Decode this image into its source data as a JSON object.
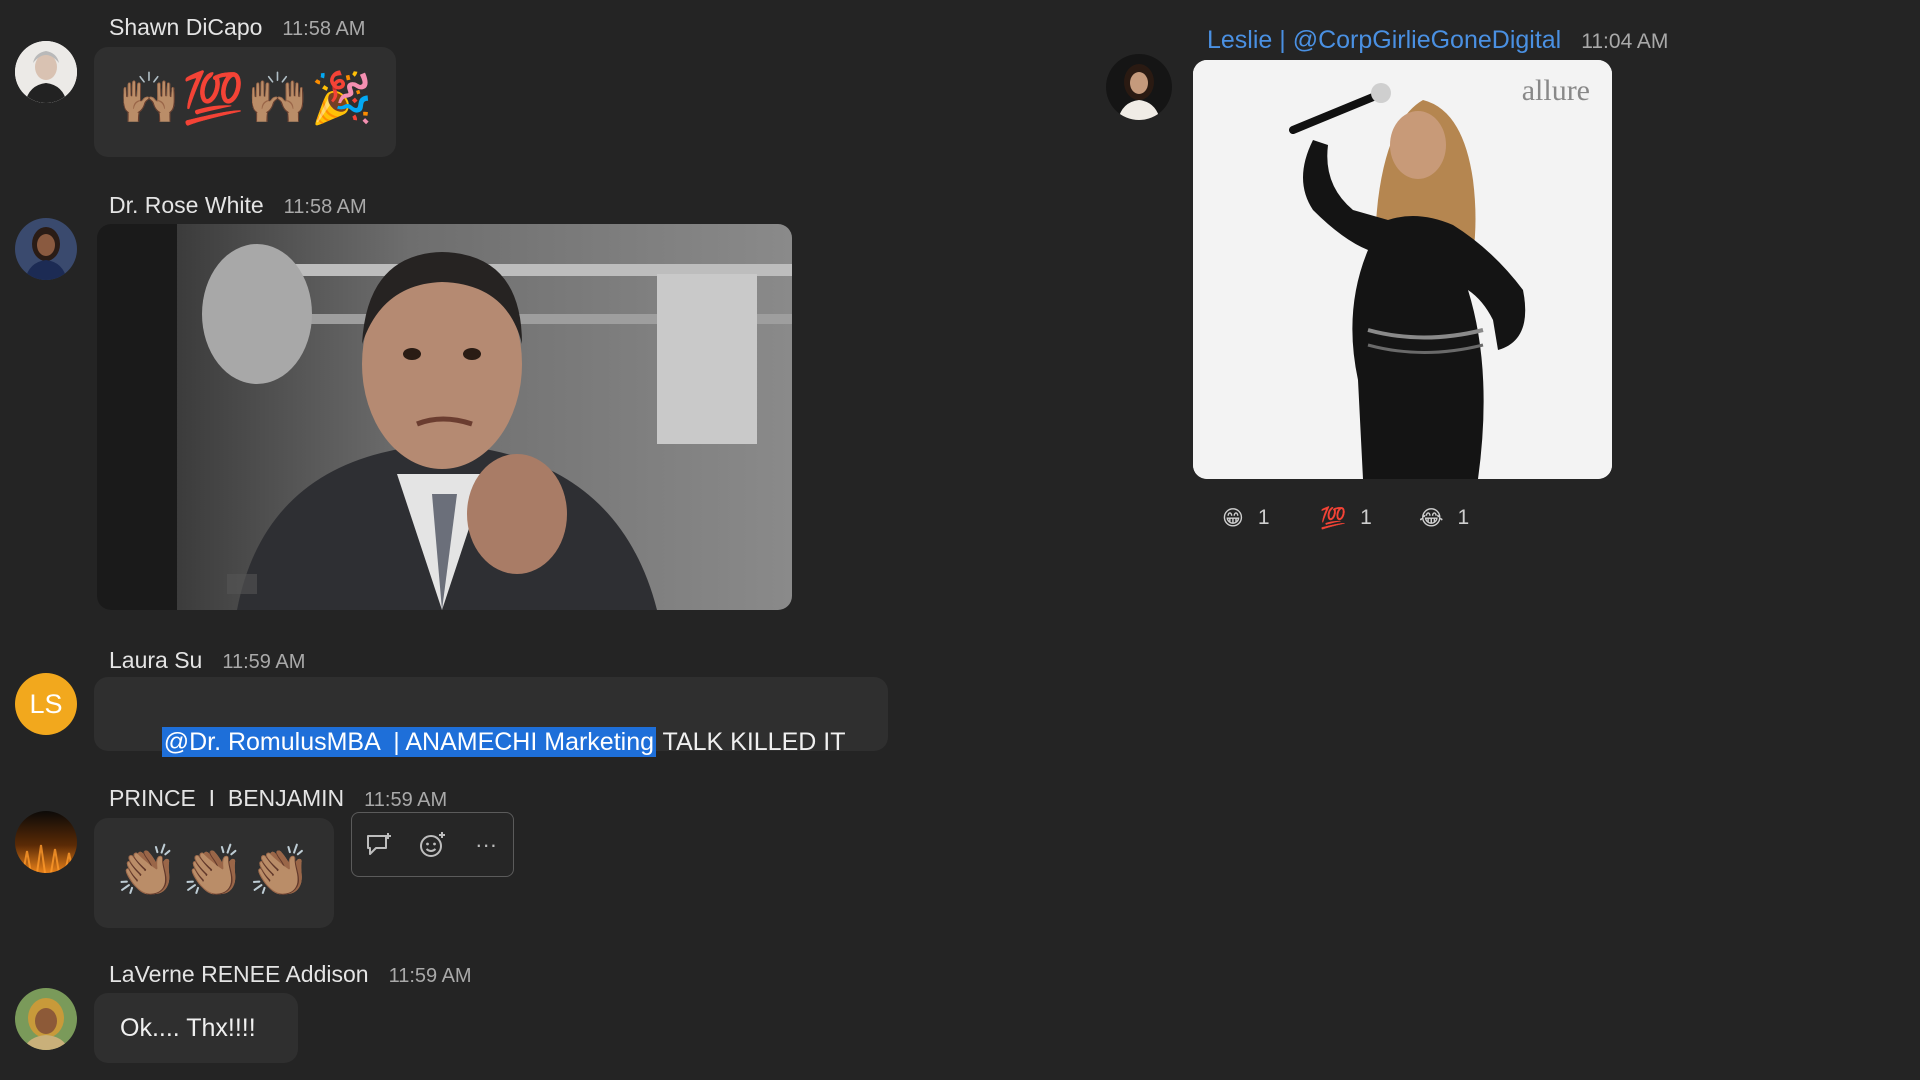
{
  "messages": [
    {
      "sender": "Shawn DiCapo",
      "time": "11:58 AM",
      "content": "🙌🏽💯🙌🏽🎉"
    },
    {
      "sender": "Dr. Rose White",
      "time": "11:58 AM",
      "gif_alt": "GIF"
    },
    {
      "sender": "Laura Su",
      "time": "11:59 AM",
      "avatar_initials": "LS",
      "mention": "@Dr. RomulusMBA  | ANAMECHI Marketing",
      "text": " TALK KILLED IT"
    },
    {
      "sender": "PRINCE  I  BENJAMIN",
      "time": "11:59 AM",
      "content": "👏🏽👏🏽👏🏽"
    },
    {
      "sender": "LaVerne RENEE Addison",
      "time": "11:59 AM",
      "text": "Ok.... Thx!!!!"
    }
  ],
  "right_message": {
    "sender": "Leslie | @CorpGirlieGoneDigital",
    "time": "11:04 AM",
    "gif_watermark": "allure",
    "reactions": [
      {
        "emoji": "😁",
        "count": "1"
      },
      {
        "emoji": "💯",
        "count": "1"
      },
      {
        "emoji": "😂",
        "count": "1"
      }
    ]
  },
  "toolbar": {
    "icons": [
      "reply-icon",
      "add-reaction-icon",
      "more-icon"
    ],
    "more_label": "···"
  },
  "colors": {
    "background": "#242424",
    "bubble": "#2f2f2f",
    "mention_highlight": "#1e6fd9",
    "link_name": "#4a90e2",
    "ls_avatar": "#f2a81d"
  }
}
